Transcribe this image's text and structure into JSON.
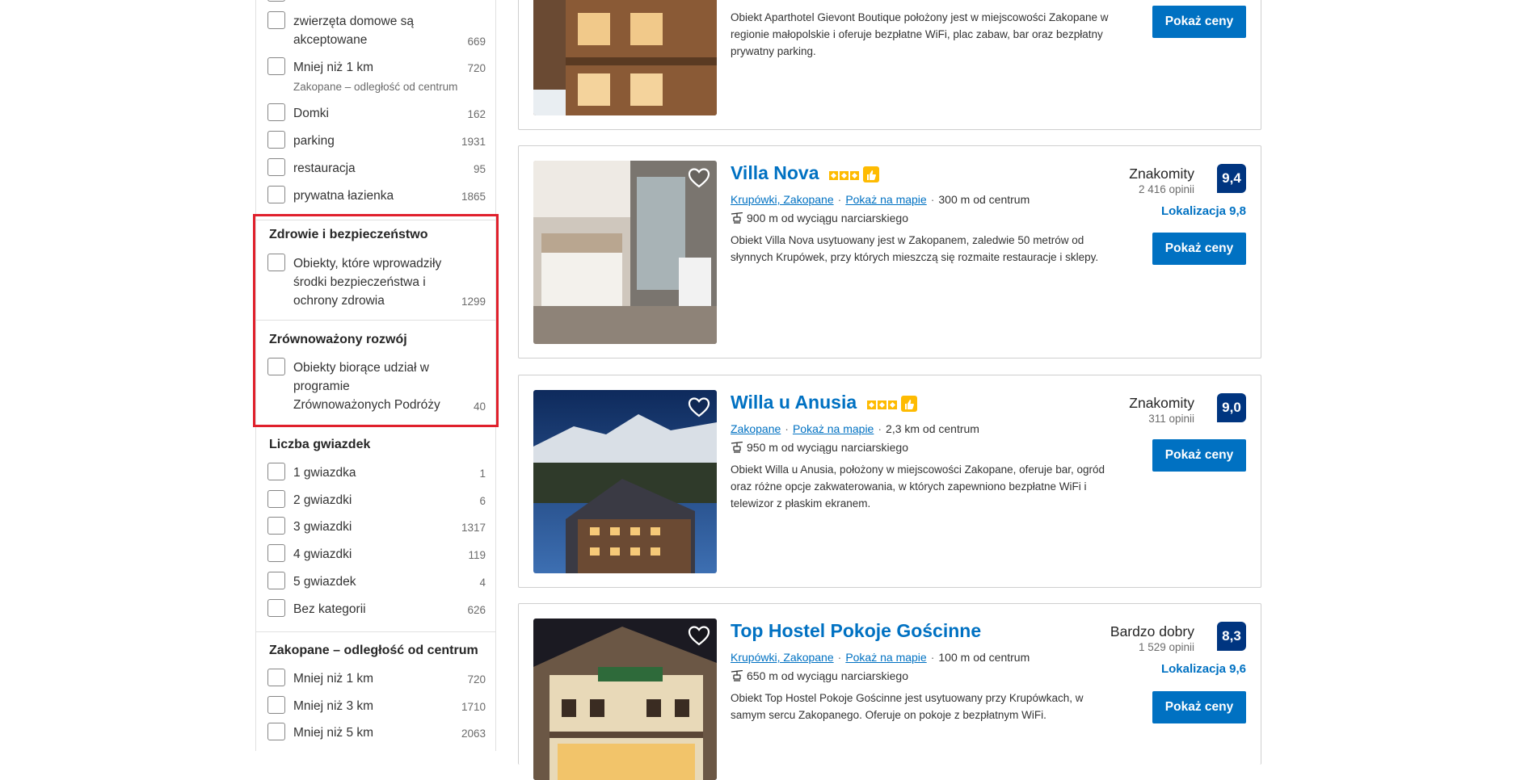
{
  "sidebar": {
    "popular": [
      {
        "label": "zwierzęta domowe są akceptowane",
        "count": "669"
      },
      {
        "label": "Mniej niż 1 km",
        "count": "720",
        "sub": "Zakopane – odległość od centrum"
      },
      {
        "label": "Domki",
        "count": "162"
      },
      {
        "label": "parking",
        "count": "1931"
      },
      {
        "label": "restauracja",
        "count": "95"
      },
      {
        "label": "prywatna łazienka",
        "count": "1865"
      }
    ],
    "health": {
      "title": "Zdrowie i bezpieczeństwo",
      "option": {
        "label": "Obiekty, które wprowadziły środki bezpieczeństwa i ochrony zdrowia",
        "count": "1299"
      }
    },
    "sustain": {
      "title": "Zrównoważony rozwój",
      "option": {
        "label": "Obiekty biorące udział w programie Zrównoważonych Podróży",
        "count": "40"
      }
    },
    "stars": {
      "title": "Liczba gwiazdek",
      "options": [
        {
          "label": "1 gwiazdka",
          "count": "1"
        },
        {
          "label": "2 gwiazdki",
          "count": "6"
        },
        {
          "label": "3 gwiazdki",
          "count": "1317"
        },
        {
          "label": "4 gwiazdki",
          "count": "119"
        },
        {
          "label": "5 gwiazdek",
          "count": "4"
        },
        {
          "label": "Bez kategorii",
          "count": "626"
        }
      ]
    },
    "distance": {
      "title": "Zakopane – odległość od centrum",
      "options": [
        {
          "label": "Mniej niż 1 km",
          "count": "720"
        },
        {
          "label": "Mniej niż 3 km",
          "count": "1710"
        },
        {
          "label": "Mniej niż 5 km",
          "count": "2063"
        }
      ]
    }
  },
  "properties": [
    {
      "desc": "Obiekt Aparthotel Gievont Boutique położony jest w miejscowości Zakopane w regionie małopolskie i oferuje bezpłatne WiFi, plac zabaw, bar oraz bezpłatny prywatny parking.",
      "button": "Pokaż ceny"
    },
    {
      "name": "Villa Nova",
      "stars": 3,
      "area": "Krupówki, Zakopane",
      "map": "Pokaż na mapie",
      "distance": "300 m od centrum",
      "ski": "900 m od wyciągu narciarskiego",
      "desc": "Obiekt Villa Nova usytuowany jest w Zakopanem, zaledwie 50 metrów od słynnych Krupówek, przy których mieszczą się rozmaite restauracje i sklepy.",
      "score_word": "Znakomity",
      "reviews": "2 416 opinii",
      "score": "9,4",
      "location_score": "Lokalizacja 9,8",
      "button": "Pokaż ceny"
    },
    {
      "name": "Willa u Anusia",
      "stars": 3,
      "area": "Zakopane",
      "map": "Pokaż na mapie",
      "distance": "2,3 km od centrum",
      "ski": "950 m od wyciągu narciarskiego",
      "desc": "Obiekt Willa u Anusia, położony w miejscowości Zakopane, oferuje bar, ogród oraz różne opcje zakwaterowania, w których zapewniono bezpłatne WiFi i telewizor z płaskim ekranem.",
      "score_word": "Znakomity",
      "reviews": "311 opinii",
      "score": "9,0",
      "button": "Pokaż ceny"
    },
    {
      "name": "Top Hostel Pokoje Gościnne",
      "area": "Krupówki, Zakopane",
      "map": "Pokaż na mapie",
      "distance": "100 m od centrum",
      "ski": "650 m od wyciągu narciarskiego",
      "desc": "Obiekt Top Hostel Pokoje Gościnne jest usytuowany przy Krupówkach, w samym sercu Zakopanego. Oferuje on pokoje z bezpłatnym WiFi.",
      "score_word": "Bardzo dobry",
      "reviews": "1 529 opinii",
      "score": "8,3",
      "location_score": "Lokalizacja 9,6",
      "button": "Pokaż ceny"
    }
  ],
  "colors": {
    "link": "#0071c2",
    "score_badge": "#003580",
    "star": "#febb02",
    "highlight": "#e0202c"
  }
}
